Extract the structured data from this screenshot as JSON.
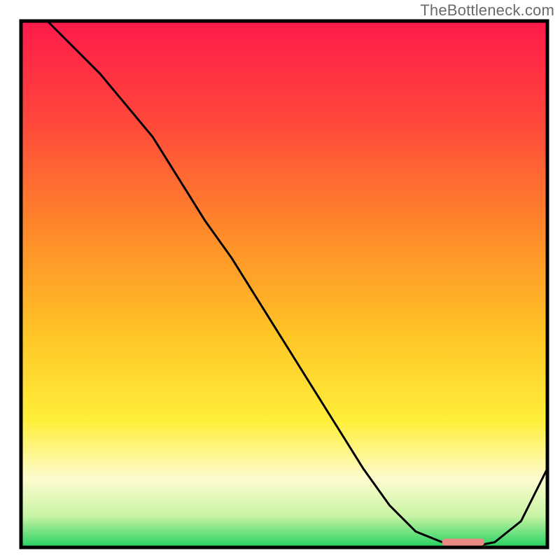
{
  "watermark": "TheBottleneck.com",
  "chart_data": {
    "type": "line",
    "title": "",
    "xlabel": "",
    "ylabel": "",
    "xlim": [
      0,
      100
    ],
    "ylim": [
      0,
      100
    ],
    "grid": false,
    "legend": false,
    "x": [
      5,
      10,
      15,
      20,
      25,
      30,
      35,
      40,
      45,
      50,
      55,
      60,
      65,
      70,
      75,
      80,
      85,
      90,
      95,
      100
    ],
    "y": [
      100,
      95,
      90,
      84,
      78,
      70,
      62,
      55,
      47,
      39,
      31,
      23,
      15,
      8,
      3,
      1,
      0,
      1,
      5,
      15
    ],
    "annotation": {
      "x_start": 80,
      "x_end": 88,
      "y": 1
    },
    "gradient_stops": [
      {
        "offset": 0.0,
        "color": "#ff1a4b"
      },
      {
        "offset": 0.2,
        "color": "#ff4a3a"
      },
      {
        "offset": 0.4,
        "color": "#ff8a2a"
      },
      {
        "offset": 0.6,
        "color": "#ffc626"
      },
      {
        "offset": 0.76,
        "color": "#ffef3a"
      },
      {
        "offset": 0.87,
        "color": "#fdfccf"
      },
      {
        "offset": 0.94,
        "color": "#c9f4a5"
      },
      {
        "offset": 1.0,
        "color": "#23d160"
      }
    ]
  }
}
